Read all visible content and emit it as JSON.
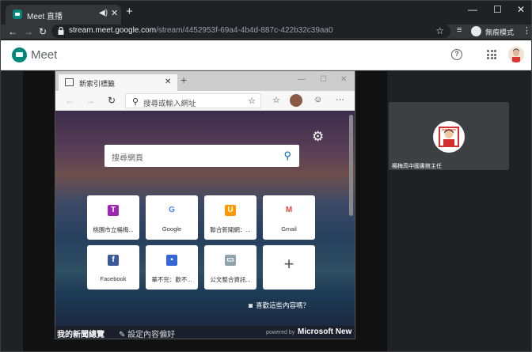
{
  "browser": {
    "tab_title": "Meet 直播",
    "tab_audio_icon": "speaker-icon",
    "new_tab": "+",
    "window_controls": [
      "—",
      "☐",
      "✕"
    ],
    "url_host": "stream.meet.google.com",
    "url_path": "/stream/4452953f-69a4-4b4d-887c-422b32c39aa0",
    "incognito_label": "無痕模式"
  },
  "meet": {
    "title": "Meet",
    "help": "?"
  },
  "shared_screen": {
    "tab_title": "新索引標籤",
    "address_placeholder": "搜尋或輸入網址",
    "settings_icon": "⚙",
    "search_placeholder": "搜尋網頁",
    "tiles": [
      {
        "label": "桃園市立楊梅...",
        "icon": "T",
        "color": "#9c27b0"
      },
      {
        "label": "Google",
        "icon": "G",
        "color": "#4285f4"
      },
      {
        "label": "聯合新聞網：...",
        "icon": "U",
        "color": "#ff9800"
      },
      {
        "label": "Gmail",
        "icon": "M",
        "color": "#ea4335"
      },
      {
        "label": "Facebook",
        "icon": "f",
        "color": "#3b5998"
      },
      {
        "label": "華不完：歡不...",
        "icon": "▪",
        "color": "#3367d6"
      },
      {
        "label": "公文整合資訊...",
        "icon": "▭",
        "color": "#90a4ae"
      },
      {
        "label": "",
        "icon": "+",
        "color": ""
      }
    ],
    "like_text": "喜歡這些內容嗎？",
    "news_label": "我的新聞總覽",
    "customize_label": "✎ 設定內容偏好",
    "powered_by": "powered by",
    "microsoft_news": "Microsoft New"
  },
  "participant": {
    "name": "楊梅高中國書館主任"
  }
}
